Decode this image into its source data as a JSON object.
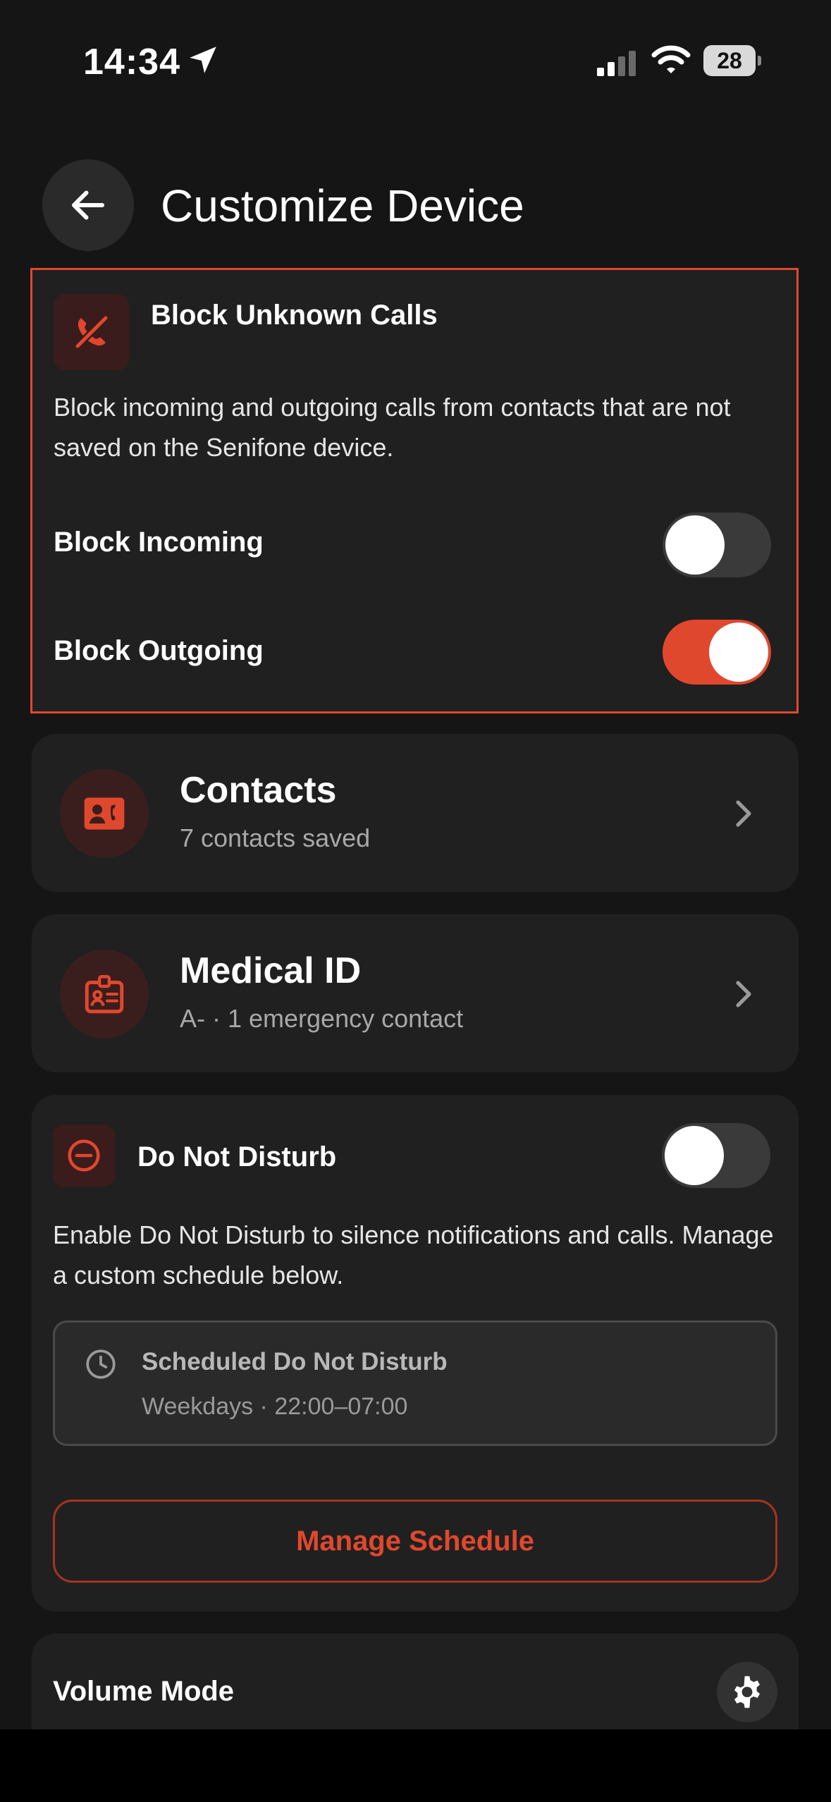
{
  "status_bar": {
    "time": "14:34",
    "battery": "28"
  },
  "header": {
    "title": "Customize Device"
  },
  "block_unknown": {
    "title": "Block Unknown Calls",
    "description": "Block incoming and outgoing calls from contacts that are not saved on the Senifone device.",
    "incoming_label": "Block Incoming",
    "incoming_on": false,
    "outgoing_label": "Block Outgoing",
    "outgoing_on": true
  },
  "contacts": {
    "title": "Contacts",
    "subtitle": "7 contacts saved"
  },
  "medical_id": {
    "title": "Medical ID",
    "subtitle": "A- · 1 emergency contact"
  },
  "dnd": {
    "title": "Do Not Disturb",
    "enabled": false,
    "description": "Enable Do Not Disturb to silence notifications and calls. Manage a custom schedule below.",
    "schedule_title": "Scheduled Do Not Disturb",
    "schedule_detail": "Weekdays · 22:00–07:00",
    "manage_label": "Manage Schedule"
  },
  "volume_mode": {
    "title": "Volume Mode"
  },
  "colors": {
    "accent": "#e0482d",
    "background": "#151515",
    "card": "#202020"
  }
}
